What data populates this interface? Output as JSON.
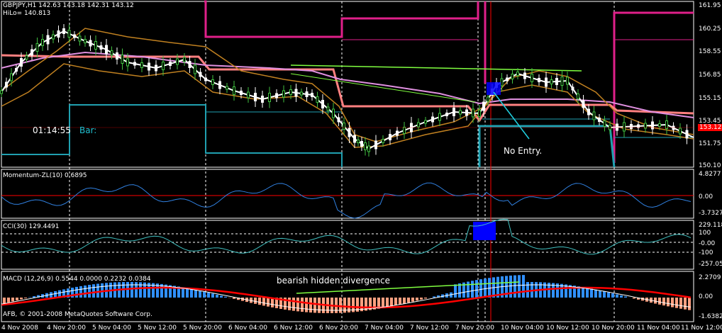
{
  "header": {
    "symbol_line": "GBPJPY,H1  142.63 143.18 142.31 143.12",
    "hilo_line": "HiLo= 140.813"
  },
  "overlay": {
    "timer": "01:14:55",
    "bar_label": "Bar:",
    "no_entry": "No Entry.",
    "divergence_note": "bearish hidden divergence",
    "copyright": "AFB, © 2001-2008 MetaQuotes Software Corp."
  },
  "colors": {
    "background": "#000000",
    "grid": "#ffffff",
    "price_white": "#ffffff",
    "salmon": "#ff8080",
    "magenta": "#e0208a",
    "teal": "#20a0b0",
    "orchid": "#e090e0",
    "goldenrod": "#c08020",
    "lime": "#80ff40",
    "candle_green": "#40c040",
    "macd_blue": "#3090ff",
    "macd_salmon": "#ffa080",
    "signal_red": "#ff0000",
    "momentum_blue": "#3080e0",
    "cci_teal": "#40c0c0",
    "price_tag": "#ff0000",
    "cci_highlight": "#0000ff"
  },
  "panels": {
    "momentum": {
      "label": "Momentum-ZL(10) 0.6895",
      "ticks": [
        "4.8277",
        "0.00",
        "-3.7327"
      ]
    },
    "cci": {
      "label": "CCI(30) 129.4491",
      "ticks": [
        "229.118",
        "100",
        "-0.00",
        "-100",
        "-257.055"
      ]
    },
    "macd": {
      "label": "MACD (12,26,9) 0.5544 0.0000 0.2232 0.0384",
      "ticks": [
        "2.2709",
        "0.00",
        "-1.6382"
      ]
    }
  },
  "price_axis": {
    "ticks": [
      "161.95",
      "160.25",
      "158.55",
      "156.85",
      "155.15",
      "153.45",
      "151.75",
      "150.10"
    ],
    "current_price": "153.12"
  },
  "time_axis": {
    "labels": [
      "4 Nov 2008",
      "4 Nov 20:00",
      "5 Nov 04:00",
      "5 Nov 12:00",
      "5 Nov 20:00",
      "6 Nov 04:00",
      "6 Nov 12:00",
      "6 Nov 20:00",
      "7 Nov 04:00",
      "7 Nov 12:00",
      "7 Nov 20:00",
      "10 Nov 04:00",
      "10 Nov 12:00",
      "10 Nov 20:00",
      "11 Nov 04:00",
      "11 Nov 12:00"
    ]
  },
  "chart_data": {
    "type": "line",
    "symbol": "GBPJPY",
    "timeframe": "H1",
    "y_range": [
      150.1,
      161.95
    ],
    "series": [
      {
        "name": "Price",
        "x": [
          "4 Nov 2008",
          "4 Nov 20:00",
          "5 Nov 04:00",
          "5 Nov 12:00",
          "5 Nov 20:00",
          "6 Nov 04:00",
          "6 Nov 12:00",
          "6 Nov 20:00",
          "7 Nov 04:00",
          "7 Nov 12:00",
          "7 Nov 20:00",
          "10 Nov 04:00",
          "10 Nov 12:00",
          "10 Nov 20:00",
          "11 Nov 04:00",
          "11 Nov 12:00"
        ],
        "values": [
          157.0,
          159.8,
          158.5,
          157.8,
          156.2,
          155.3,
          155.4,
          153.3,
          151.3,
          152.9,
          154.1,
          155.6,
          156.0,
          153.1,
          153.0,
          152.5
        ]
      }
    ]
  }
}
